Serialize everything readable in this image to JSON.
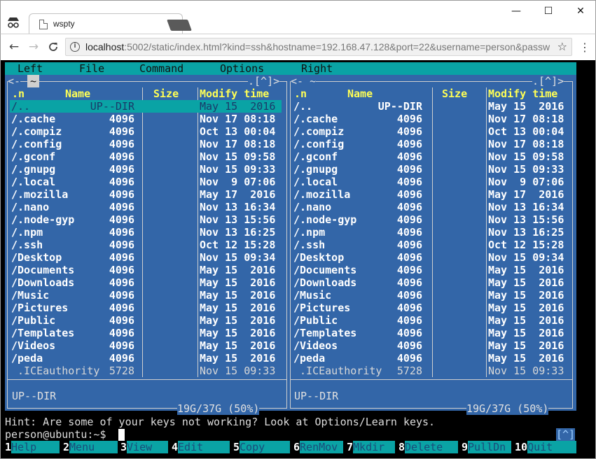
{
  "browser": {
    "tab_title": "wspty",
    "tab_close": "×",
    "minimize": "—",
    "maximize": "☐",
    "close": "✕",
    "back": "←",
    "forward": "→",
    "reload": "C",
    "url_host": "localhost",
    "url_rest": ":5002/static/index.html?kind=ssh&hostname=192.168.47.128&port=22&username=person&passw",
    "star": "☆",
    "menu": "⋮"
  },
  "mc": {
    "menubar": [
      "Left",
      "File",
      "Command",
      "Options",
      "Right"
    ],
    "left_panel": {
      "path_tab": "~",
      "frame_right": ".[^]>",
      "frame_left": "<-",
      "headers": {
        "n": ".n",
        "name": "Name",
        "size": "Size",
        "modify": "Modify time"
      },
      "footer_label": "UP--DIR",
      "disk": "19G/37G (50%)"
    },
    "right_panel": {
      "frame_left": "<- ~",
      "frame_right": ".[^]>",
      "headers": {
        "n": ".n",
        "name": "Name",
        "size": "Size",
        "modify": "Modify time"
      },
      "footer_label": "UP--DIR",
      "disk": "19G/37G (50%)"
    },
    "left_rows": [
      {
        "name": "/..",
        "size": "UP--DIR",
        "mod": "May 15  2016"
      },
      {
        "name": "/.cache",
        "size": "4096",
        "mod": "Nov 17 08:18"
      },
      {
        "name": "/.compiz",
        "size": "4096",
        "mod": "Oct 13 00:04"
      },
      {
        "name": "/.config",
        "size": "4096",
        "mod": "Nov 17 08:18"
      },
      {
        "name": "/.gconf",
        "size": "4096",
        "mod": "Nov 15 09:58"
      },
      {
        "name": "/.gnupg",
        "size": "4096",
        "mod": "Nov 15 09:33"
      },
      {
        "name": "/.local",
        "size": "4096",
        "mod": "Nov  9 07:06"
      },
      {
        "name": "/.mozilla",
        "size": "4096",
        "mod": "May 17  2016"
      },
      {
        "name": "/.nano",
        "size": "4096",
        "mod": "Nov 13 16:34"
      },
      {
        "name": "/.node-gyp",
        "size": "4096",
        "mod": "Nov 13 15:56"
      },
      {
        "name": "/.npm",
        "size": "4096",
        "mod": "Nov 13 16:25"
      },
      {
        "name": "/.ssh",
        "size": "4096",
        "mod": "Oct 12 15:28"
      },
      {
        "name": "/Desktop",
        "size": "4096",
        "mod": "Nov 15 09:34"
      },
      {
        "name": "/Documents",
        "size": "4096",
        "mod": "May 15  2016"
      },
      {
        "name": "/Downloads",
        "size": "4096",
        "mod": "May 15  2016"
      },
      {
        "name": "/Music",
        "size": "4096",
        "mod": "May 15  2016"
      },
      {
        "name": "/Pictures",
        "size": "4096",
        "mod": "May 15  2016"
      },
      {
        "name": "/Public",
        "size": "4096",
        "mod": "May 15  2016"
      },
      {
        "name": "/Templates",
        "size": "4096",
        "mod": "May 15  2016"
      },
      {
        "name": "/Videos",
        "size": "4096",
        "mod": "May 15  2016"
      },
      {
        "name": "/peda",
        "size": "4096",
        "mod": "May 15  2016"
      },
      {
        "name": " .ICEauthority",
        "size": "5728",
        "mod": "Nov 15 09:33"
      }
    ],
    "right_rows": [
      {
        "name": "/..",
        "size": "UP--DIR",
        "mod": "May 15  2016"
      },
      {
        "name": "/.cache",
        "size": "4096",
        "mod": "Nov 17 08:18"
      },
      {
        "name": "/.compiz",
        "size": "4096",
        "mod": "Oct 13 00:04"
      },
      {
        "name": "/.config",
        "size": "4096",
        "mod": "Nov 17 08:18"
      },
      {
        "name": "/.gconf",
        "size": "4096",
        "mod": "Nov 15 09:58"
      },
      {
        "name": "/.gnupg",
        "size": "4096",
        "mod": "Nov 15 09:33"
      },
      {
        "name": "/.local",
        "size": "4096",
        "mod": "Nov  9 07:06"
      },
      {
        "name": "/.mozilla",
        "size": "4096",
        "mod": "May 17  2016"
      },
      {
        "name": "/.nano",
        "size": "4096",
        "mod": "Nov 13 16:34"
      },
      {
        "name": "/.node-gyp",
        "size": "4096",
        "mod": "Nov 13 15:56"
      },
      {
        "name": "/.npm",
        "size": "4096",
        "mod": "Nov 13 16:25"
      },
      {
        "name": "/.ssh",
        "size": "4096",
        "mod": "Oct 12 15:28"
      },
      {
        "name": "/Desktop",
        "size": "4096",
        "mod": "Nov 15 09:34"
      },
      {
        "name": "/Documents",
        "size": "4096",
        "mod": "May 15  2016"
      },
      {
        "name": "/Downloads",
        "size": "4096",
        "mod": "May 15  2016"
      },
      {
        "name": "/Music",
        "size": "4096",
        "mod": "May 15  2016"
      },
      {
        "name": "/Pictures",
        "size": "4096",
        "mod": "May 15  2016"
      },
      {
        "name": "/Public",
        "size": "4096",
        "mod": "May 15  2016"
      },
      {
        "name": "/Templates",
        "size": "4096",
        "mod": "May 15  2016"
      },
      {
        "name": "/Videos",
        "size": "4096",
        "mod": "May 15  2016"
      },
      {
        "name": "/peda",
        "size": "4096",
        "mod": "May 15  2016"
      },
      {
        "name": " .ICEauthority",
        "size": "5728",
        "mod": "Nov 15 09:33"
      }
    ],
    "hint": "Hint: Are some of your keys not working? Look at Options/Learn keys.",
    "prompt": "person@ubuntu:~$",
    "bracket_up": "[^]",
    "fnkeys": [
      {
        "num": "1",
        "label": "Help"
      },
      {
        "num": "2",
        "label": "Menu"
      },
      {
        "num": "3",
        "label": "View"
      },
      {
        "num": "4",
        "label": "Edit"
      },
      {
        "num": "5",
        "label": "Copy"
      },
      {
        "num": "6",
        "label": "RenMov"
      },
      {
        "num": "7",
        "label": "Mkdir"
      },
      {
        "num": "8",
        "label": "Delete"
      },
      {
        "num": "9",
        "label": "PullDn"
      },
      {
        "num": "10",
        "label": "Quit"
      }
    ]
  },
  "colors": {
    "panel_bg": "#3366a8",
    "accent_cyan": "#0aa3a5",
    "header_yellow": "#ffff55",
    "terminal_bg": "#000000"
  }
}
